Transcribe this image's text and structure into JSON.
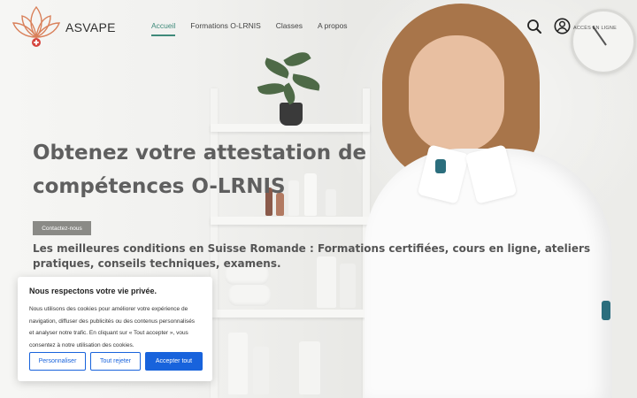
{
  "site": {
    "brand": "ASVAPE"
  },
  "nav": {
    "items": [
      {
        "label": "Accueil",
        "active": true
      },
      {
        "label": "Formations O-LRNIS",
        "active": false
      },
      {
        "label": "Classes",
        "active": false
      },
      {
        "label": "A propos",
        "active": false
      }
    ]
  },
  "header": {
    "search_icon": "search-icon",
    "account_icon": "user-circle-icon",
    "account_label": "ACCÈS EN LIGNE"
  },
  "hero": {
    "title_line1": "Obtenez votre attestation de",
    "title_line2": "compétences O-LRNIS",
    "contact_label": "Contactez-nous",
    "subtitle": "Les meilleures conditions en Suisse Romande :  Formations certifiées, cours en ligne, ateliers pratiques, conseils techniques, examens."
  },
  "cookie_banner": {
    "title": "Nous respectons votre vie privée.",
    "text": "Nous utilisons des cookies pour améliorer votre expérience de navigation, diffuser des publicités ou des contenus personnalisés et analyser notre trafic. En cliquant sur « Tout accepter », vous consentez à notre utilisation des cookies.",
    "customize_label": "Personnaliser",
    "reject_label": "Tout rejeter",
    "accept_label": "Accepter tout"
  },
  "colors": {
    "accent": "#3f8a7a",
    "cookie_primary": "#1863dc",
    "logo_orange": "#d9805a",
    "logo_red": "#d6453d"
  }
}
